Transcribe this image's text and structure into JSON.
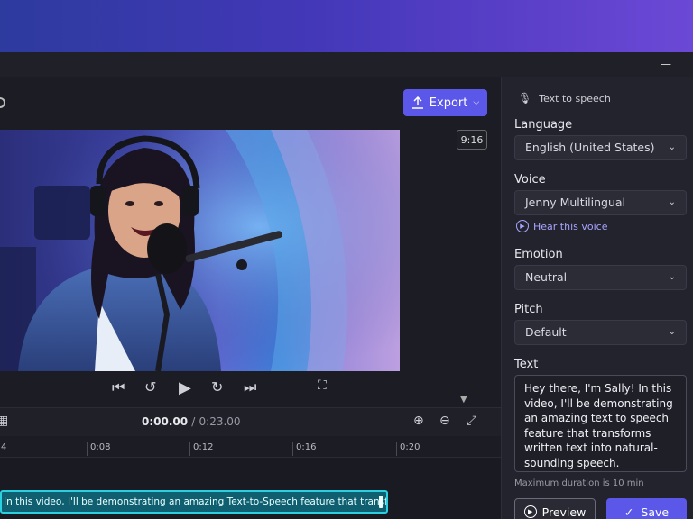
{
  "toolbar": {
    "export_label": "Export",
    "ratio": "9:16"
  },
  "player": {
    "current_time": "0:00.00",
    "separator": "/",
    "total_time": "0:23.00"
  },
  "ruler": {
    "ticks": [
      "4",
      "0:08",
      "0:12",
      "0:16",
      "0:20"
    ]
  },
  "caption_track": {
    "text": "In this video, I'll be demonstrating an amazing Text-to-Speech feature that transforms wr"
  },
  "panel": {
    "title": "Text to speech",
    "language_label": "Language",
    "language_value": "English (United States)",
    "voice_label": "Voice",
    "voice_value": "Jenny Multilingual",
    "hear_voice": "Hear this voice",
    "emotion_label": "Emotion",
    "emotion_value": "Neutral",
    "pitch_label": "Pitch",
    "pitch_value": "Default",
    "text_label": "Text",
    "text_value": "Hey there, I'm Sally! In this video, I'll be demonstrating an amazing text to speech feature that transforms written text into natural-sounding speech.",
    "max_duration": "Maximum duration is 10 min",
    "preview_label": "Preview",
    "save_label": "Save"
  },
  "colors": {
    "accent": "#5b57e8",
    "caption": "#0f5f70",
    "caption_border": "#2ad0e0",
    "link": "#a9a4ff"
  }
}
